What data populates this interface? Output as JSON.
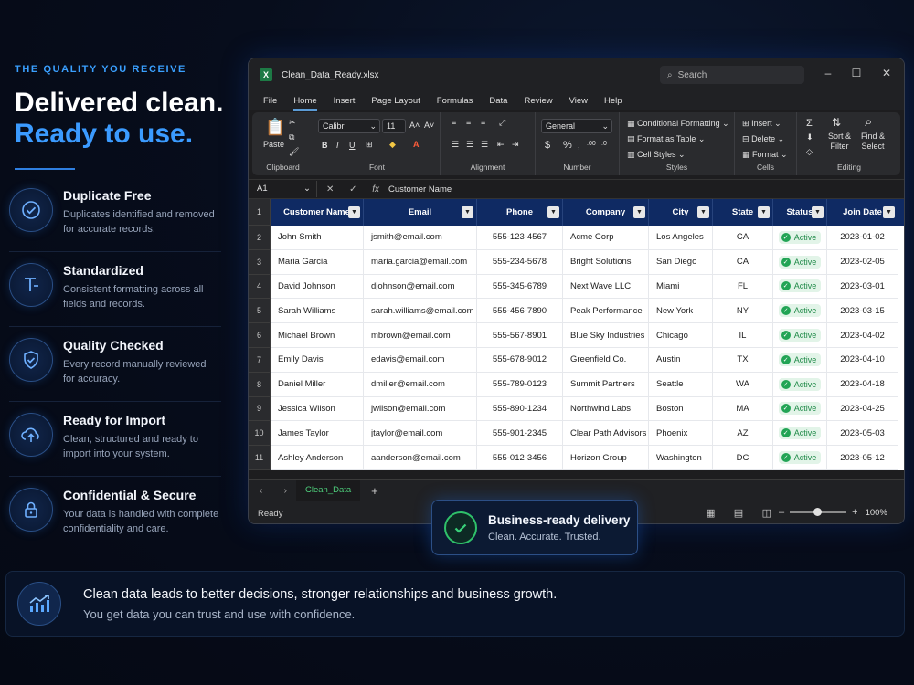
{
  "eyebrow": "THE QUALITY YOU RECEIVE",
  "headline": {
    "line1": "Delivered clean.",
    "line2": "Ready to use."
  },
  "features": [
    {
      "title": "Duplicate Free",
      "desc1": "Duplicates identified and removed",
      "desc2": "for accurate records.",
      "icon": "check-circle-icon"
    },
    {
      "title": "Standardized",
      "desc1": "Consistent formatting across all",
      "desc2": "fields and records.",
      "icon": "text-format-icon"
    },
    {
      "title": "Quality Checked",
      "desc1": "Every record manually reviewed",
      "desc2": "for accuracy.",
      "icon": "shield-check-icon"
    },
    {
      "title": "Ready for Import",
      "desc1": "Clean, structured and ready to",
      "desc2": "import into your system.",
      "icon": "cloud-upload-icon"
    },
    {
      "title": "Confidential & Secure",
      "desc1": "Your data is handled with complete",
      "desc2": "confidentiality and care.",
      "icon": "lock-icon"
    }
  ],
  "excel": {
    "filename": "Clean_Data_Ready.xlsx",
    "search_placeholder": "Search",
    "menus": [
      "File",
      "Home",
      "Insert",
      "Page Layout",
      "Formulas",
      "Data",
      "Review",
      "View",
      "Help"
    ],
    "ribbon": {
      "paste": "Paste",
      "clipboard": "Clipboard",
      "font_name": "Calibri",
      "font_size": "11",
      "font": "Font",
      "alignment": "Alignment",
      "number_format": "General",
      "number": "Number",
      "conditional_formatting": "Conditional Formatting",
      "format_as_table": "Format as Table",
      "cell_styles": "Cell Styles",
      "styles": "Styles",
      "insert": "Insert",
      "delete": "Delete",
      "format": "Format",
      "cells": "Cells",
      "sort_filter": "Sort &",
      "sort_filter2": "Filter",
      "find_select": "Find &",
      "find_select2": "Select",
      "editing": "Editing"
    },
    "name_box": "A1",
    "formula_value": "Customer Name",
    "headers": [
      "Customer Name",
      "Email",
      "Phone",
      "Company",
      "City",
      "State",
      "Status",
      "Join Date"
    ],
    "rows": [
      [
        "John Smith",
        "jsmith@email.com",
        "555-123-4567",
        "Acme Corp",
        "Los Angeles",
        "CA",
        "Active",
        "2023-01-02"
      ],
      [
        "Maria Garcia",
        "maria.garcia@email.com",
        "555-234-5678",
        "Bright Solutions",
        "San Diego",
        "CA",
        "Active",
        "2023-02-05"
      ],
      [
        "David Johnson",
        "djohnson@email.com",
        "555-345-6789",
        "Next Wave LLC",
        "Miami",
        "FL",
        "Active",
        "2023-03-01"
      ],
      [
        "Sarah Williams",
        "sarah.williams@email.com",
        "555-456-7890",
        "Peak Performance",
        "New York",
        "NY",
        "Active",
        "2023-03-15"
      ],
      [
        "Michael Brown",
        "mbrown@email.com",
        "555-567-8901",
        "Blue Sky Industries",
        "Chicago",
        "IL",
        "Active",
        "2023-04-02"
      ],
      [
        "Emily Davis",
        "edavis@email.com",
        "555-678-9012",
        "Greenfield Co.",
        "Austin",
        "TX",
        "Active",
        "2023-04-10"
      ],
      [
        "Daniel Miller",
        "dmiller@email.com",
        "555-789-0123",
        "Summit Partners",
        "Seattle",
        "WA",
        "Active",
        "2023-04-18"
      ],
      [
        "Jessica Wilson",
        "jwilson@email.com",
        "555-890-1234",
        "Northwind Labs",
        "Boston",
        "MA",
        "Active",
        "2023-04-25"
      ],
      [
        "James Taylor",
        "jtaylor@email.com",
        "555-901-2345",
        "Clear Path Advisors",
        "Phoenix",
        "AZ",
        "Active",
        "2023-05-03"
      ],
      [
        "Ashley Anderson",
        "aanderson@email.com",
        "555-012-3456",
        "Horizon Group",
        "Washington",
        "DC",
        "Active",
        "2023-05-12"
      ]
    ],
    "row_numbers": [
      "1",
      "2",
      "3",
      "4",
      "5",
      "6",
      "7",
      "8",
      "9",
      "10",
      "11"
    ],
    "sheet_tab": "Clean_Data",
    "status": "Ready",
    "zoom": "100%"
  },
  "delivery": {
    "title": "Business-ready delivery",
    "subtitle": "Clean. Accurate. Trusted."
  },
  "banner": {
    "title": "Clean data leads to better decisions, stronger relationships and business growth.",
    "subtitle": "You get data you can trust and use with confidence."
  },
  "colors": {
    "accent": "#3b9bff",
    "header_blue": "#0f2a63",
    "success": "#22a455"
  }
}
